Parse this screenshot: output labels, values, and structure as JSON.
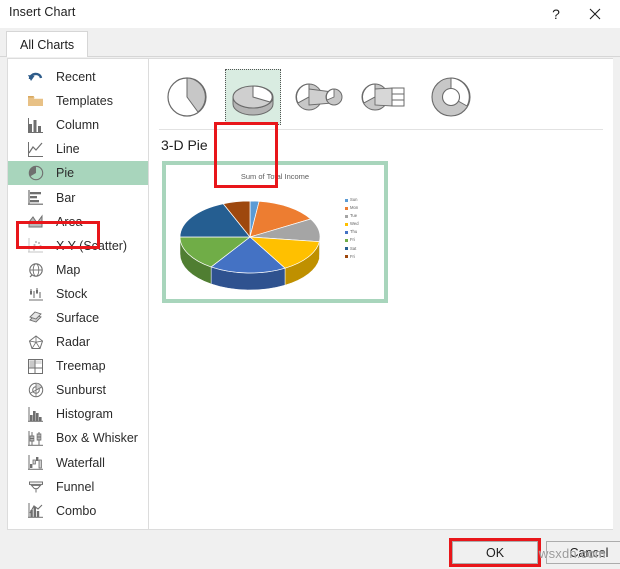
{
  "window": {
    "title": "Insert Chart",
    "help_label": "?",
    "close_label": "✕"
  },
  "tabs": [
    {
      "label": "All Charts",
      "active": true
    }
  ],
  "sidebar": {
    "items": [
      {
        "label": "Recent",
        "icon": "recent-icon",
        "selected": false
      },
      {
        "label": "Templates",
        "icon": "templates-icon",
        "selected": false
      },
      {
        "label": "Column",
        "icon": "column-icon",
        "selected": false
      },
      {
        "label": "Line",
        "icon": "line-icon",
        "selected": false
      },
      {
        "label": "Pie",
        "icon": "pie-icon",
        "selected": true
      },
      {
        "label": "Bar",
        "icon": "bar-icon",
        "selected": false
      },
      {
        "label": "Area",
        "icon": "area-icon",
        "selected": false
      },
      {
        "label": "X Y (Scatter)",
        "icon": "scatter-icon",
        "selected": false
      },
      {
        "label": "Map",
        "icon": "map-icon",
        "selected": false
      },
      {
        "label": "Stock",
        "icon": "stock-icon",
        "selected": false
      },
      {
        "label": "Surface",
        "icon": "surface-icon",
        "selected": false
      },
      {
        "label": "Radar",
        "icon": "radar-icon",
        "selected": false
      },
      {
        "label": "Treemap",
        "icon": "treemap-icon",
        "selected": false
      },
      {
        "label": "Sunburst",
        "icon": "sunburst-icon",
        "selected": false
      },
      {
        "label": "Histogram",
        "icon": "histogram-icon",
        "selected": false
      },
      {
        "label": "Box & Whisker",
        "icon": "box-whisker-icon",
        "selected": false
      },
      {
        "label": "Waterfall",
        "icon": "waterfall-icon",
        "selected": false
      },
      {
        "label": "Funnel",
        "icon": "funnel-icon",
        "selected": false
      },
      {
        "label": "Combo",
        "icon": "combo-icon",
        "selected": false
      }
    ]
  },
  "main": {
    "chart_types": [
      {
        "name": "pie",
        "selected": false
      },
      {
        "name": "3d-pie",
        "selected": true
      },
      {
        "name": "pie-of-pie",
        "selected": false
      },
      {
        "name": "bar-of-pie",
        "selected": false
      },
      {
        "name": "doughnut",
        "selected": false
      }
    ],
    "preview_heading": "3-D Pie"
  },
  "chart_data": {
    "type": "pie",
    "title": "Sum of Total Income",
    "xlabel": "",
    "ylabel": "",
    "legend_position": "right",
    "grid": false,
    "categories": [
      "Sun",
      "Mon",
      "Tue",
      "Wed",
      "Thu",
      "Fri",
      "Sat",
      "Fri"
    ],
    "values": [
      2,
      14,
      10,
      14,
      17,
      15,
      18,
      6
    ],
    "colors": [
      "#5b9bd5",
      "#ed7d31",
      "#a5a5a5",
      "#ffc000",
      "#4472c4",
      "#70ad47",
      "#255e91",
      "#9e480e"
    ],
    "side_colors": [
      "#41719c",
      "#ae5a21",
      "#747474",
      "#bf9000",
      "#2f528f",
      "#507e32",
      "#1b4467",
      "#6e3207"
    ]
  },
  "footer": {
    "ok_label": "OK",
    "cancel_label": "Cancel"
  },
  "watermark": {
    "text": "wsxdn.com"
  },
  "annotations": {
    "accent_color": "#e8161a",
    "selection_color": "#a8d5bc"
  }
}
